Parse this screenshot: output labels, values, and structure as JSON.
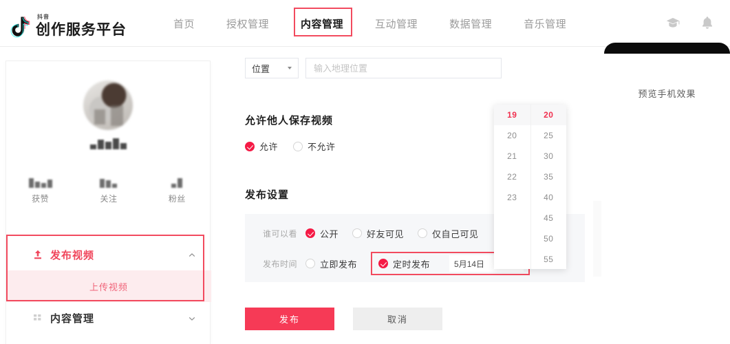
{
  "header": {
    "brand_sub": "抖音",
    "brand_title": "创作服务平台",
    "logo_icon": "tiktok-note-icon",
    "nav": [
      {
        "label": "首页",
        "active": false
      },
      {
        "label": "授权管理",
        "active": false
      },
      {
        "label": "内容管理",
        "active": true
      },
      {
        "label": "互动管理",
        "active": false
      },
      {
        "label": "数据管理",
        "active": false
      },
      {
        "label": "音乐管理",
        "active": false
      }
    ],
    "icons": [
      {
        "name": "graduation-cap-icon"
      },
      {
        "name": "bell-icon"
      }
    ]
  },
  "sidebar": {
    "avatar_alt": "用户头像",
    "nickname_redacted": "",
    "stats": [
      {
        "value": "",
        "label": "获赞"
      },
      {
        "value": "",
        "label": "关注"
      },
      {
        "value": "",
        "label": "粉丝"
      }
    ],
    "menu": [
      {
        "label": "发布视频",
        "icon": "upload-icon",
        "chevron": "chevron-up-icon",
        "expanded": true
      },
      {
        "label": "内容管理",
        "icon": "grid-icon",
        "chevron": "chevron-down-icon",
        "expanded": false
      }
    ],
    "submenu": [
      {
        "label": "上传视频",
        "active": true
      }
    ]
  },
  "form": {
    "location": {
      "select_label": "位置",
      "input_value": "",
      "input_placeholder": "输入地理位置"
    },
    "allow_save": {
      "title": "允许他人保存视频",
      "options": [
        {
          "label": "允许",
          "checked": true
        },
        {
          "label": "不允许",
          "checked": false
        }
      ]
    },
    "publish_settings": {
      "title": "发布设置",
      "visibility": {
        "label": "谁可以看",
        "options": [
          {
            "label": "公开",
            "checked": true
          },
          {
            "label": "好友可见",
            "checked": false
          },
          {
            "label": "仅自己可见",
            "checked": false
          }
        ]
      },
      "publish_time": {
        "label": "发布时间",
        "options": [
          {
            "label": "立即发布",
            "checked": false
          },
          {
            "label": "定时发布",
            "checked": true
          }
        ],
        "date_value": "5月14日",
        "calendar_icon": "calendar-icon"
      }
    },
    "buttons": {
      "submit": "发布",
      "cancel": "取消"
    }
  },
  "time_picker": {
    "hours": [
      {
        "value": "19",
        "selected": true
      },
      {
        "value": "20",
        "selected": false
      },
      {
        "value": "21",
        "selected": false
      },
      {
        "value": "22",
        "selected": false
      },
      {
        "value": "23",
        "selected": false
      }
    ],
    "minutes": [
      {
        "value": "20",
        "selected": true
      },
      {
        "value": "25",
        "selected": false
      },
      {
        "value": "30",
        "selected": false
      },
      {
        "value": "35",
        "selected": false
      },
      {
        "value": "40",
        "selected": false
      },
      {
        "value": "45",
        "selected": false
      },
      {
        "value": "50",
        "selected": false
      },
      {
        "value": "55",
        "selected": false
      }
    ]
  },
  "preview": {
    "text": "预览手机效果"
  },
  "colors": {
    "accent_red": "#f63a56",
    "annotation_red": "#f24a5e",
    "panel_gray": "#f6f7f9",
    "submenu_pink": "#fdecee"
  }
}
